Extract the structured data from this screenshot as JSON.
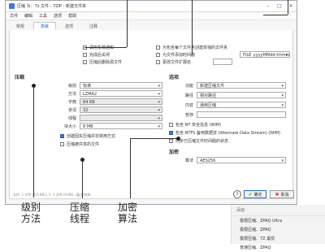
{
  "window": {
    "title": "压缩  为：7z 文件 - 7ZIP - 新建文件夹"
  },
  "menu": [
    "文件",
    "编辑",
    "工具",
    "选项",
    "帮助"
  ],
  "tabs": [
    "常规",
    "高级",
    "选项",
    "注释"
  ],
  "general": {
    "checks": [
      {
        "label": "调用系统通知",
        "checked": false
      },
      {
        "label": "完成后关闭",
        "checked": false
      },
      {
        "label": "压缩后删除源文件",
        "checked": false
      }
    ],
    "right_checks": [
      {
        "label": "为包含每个文件夹创建单独的文件夹",
        "checked": false
      },
      {
        "label": "为文件添加时间戳",
        "checked": false
      },
      {
        "label": "更改文件扩展名",
        "checked": false
      }
    ],
    "timestamp_format": "FILE_yyyyMMdd-hhmmss"
  },
  "compression": {
    "section": "压缩",
    "rows": [
      {
        "label": "级别",
        "value": "标准"
      },
      {
        "label": "方法",
        "value": "LZMA2"
      },
      {
        "label": "字典",
        "value": "64 KB"
      },
      {
        "label": "单词",
        "value": "32"
      },
      {
        "label": "线程",
        "value": ""
      },
      {
        "label": "块大小",
        "value": "8 MB"
      }
    ],
    "checks": [
      {
        "label": "创建固实压缩并非常用方式",
        "checked": true
      },
      {
        "label": "压缩被共享的文件",
        "checked": false
      }
    ]
  },
  "options": {
    "section": "选项",
    "rows": [
      {
        "label": "功能",
        "value": "新建压缩文件"
      },
      {
        "label": "路径",
        "value": "相对路径"
      },
      {
        "label": "内容",
        "value": "通用压缩"
      },
      {
        "label": "暂存",
        "value": ""
      }
    ],
    "checks": [
      {
        "label": "包含 NT 安全信息 (WIM)",
        "checked": false
      },
      {
        "label": "包含 NTFS 备用数据流 (Alternate Data Stream) (WIM)",
        "checked": true
      },
      {
        "label": "同步已压缩文件时间戳的状态",
        "checked": false
      }
    ]
  },
  "encryption": {
    "section": "加密",
    "label": "算法",
    "value": "AES256"
  },
  "status": "文件: 1 文件 (4.6 KB) | 5: 1 文件 (0 KB)  | 备注/结构",
  "buttons": {
    "ok": "确定",
    "cancel": "取消",
    "help": "?"
  },
  "callouts": {
    "level": "级别\n方法",
    "compress": "压缩\n线程",
    "encrypt": "加密\n算法"
  },
  "popup": {
    "header": "添加",
    "items": [
      "极限压缩、ZPAQ Ultra",
      "极限压缩、ZPAQ",
      "极限压缩、7Z 最优",
      "普通压缩、ZPAQ"
    ]
  },
  "colors": {
    "accent": "#3b7bd6",
    "ok_green": "#2f9e44",
    "cancel_red": "#d33131"
  }
}
